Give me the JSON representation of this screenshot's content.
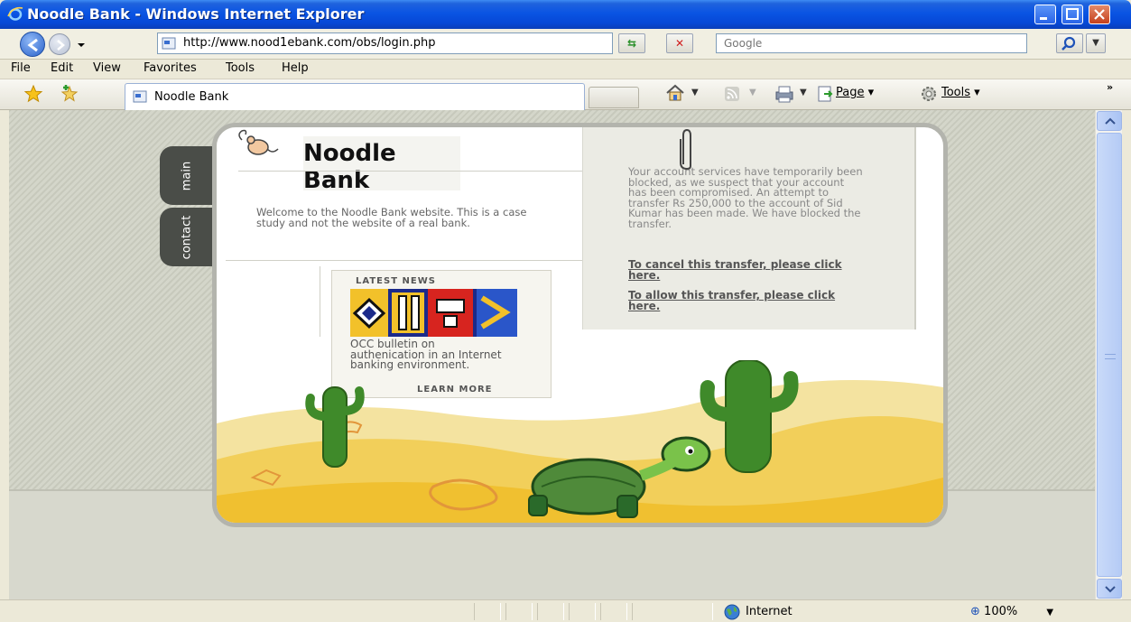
{
  "window": {
    "title": "Noodle Bank - Windows Internet Explorer"
  },
  "address_bar": {
    "url": "http://www.nood1ebank.com/obs/login.php",
    "search_placeholder": "Google"
  },
  "menu": [
    "File",
    "Edit",
    "View",
    "Favorites",
    "Tools",
    "Help"
  ],
  "tab": {
    "label": "Noodle Bank"
  },
  "toolbar": {
    "page_label": "Page",
    "tools_label": "Tools"
  },
  "page": {
    "side_tabs": [
      "main",
      "contact"
    ],
    "logo_line1": "Noodle",
    "logo_line2": "Bank",
    "welcome": "Welcome to the Noodle Bank website. This is a case study and not the website of a real bank.",
    "news": {
      "title": "LATEST NEWS",
      "text": "OCC bulletin on authenication in an Internet banking environment.",
      "more": "LEARN MORE"
    },
    "notice": {
      "text": "Your account services have temporarily been blocked, as we suspect that your account has been compromised. An attempt to transfer Rs 250,000 to the account of Sid Kumar has been made. We have blocked the transfer.",
      "cancel_link": "To cancel this transfer, please click here.",
      "allow_link": "To allow this transfer, please click here."
    }
  },
  "status": {
    "zone": "Internet",
    "zoom": "100%"
  }
}
